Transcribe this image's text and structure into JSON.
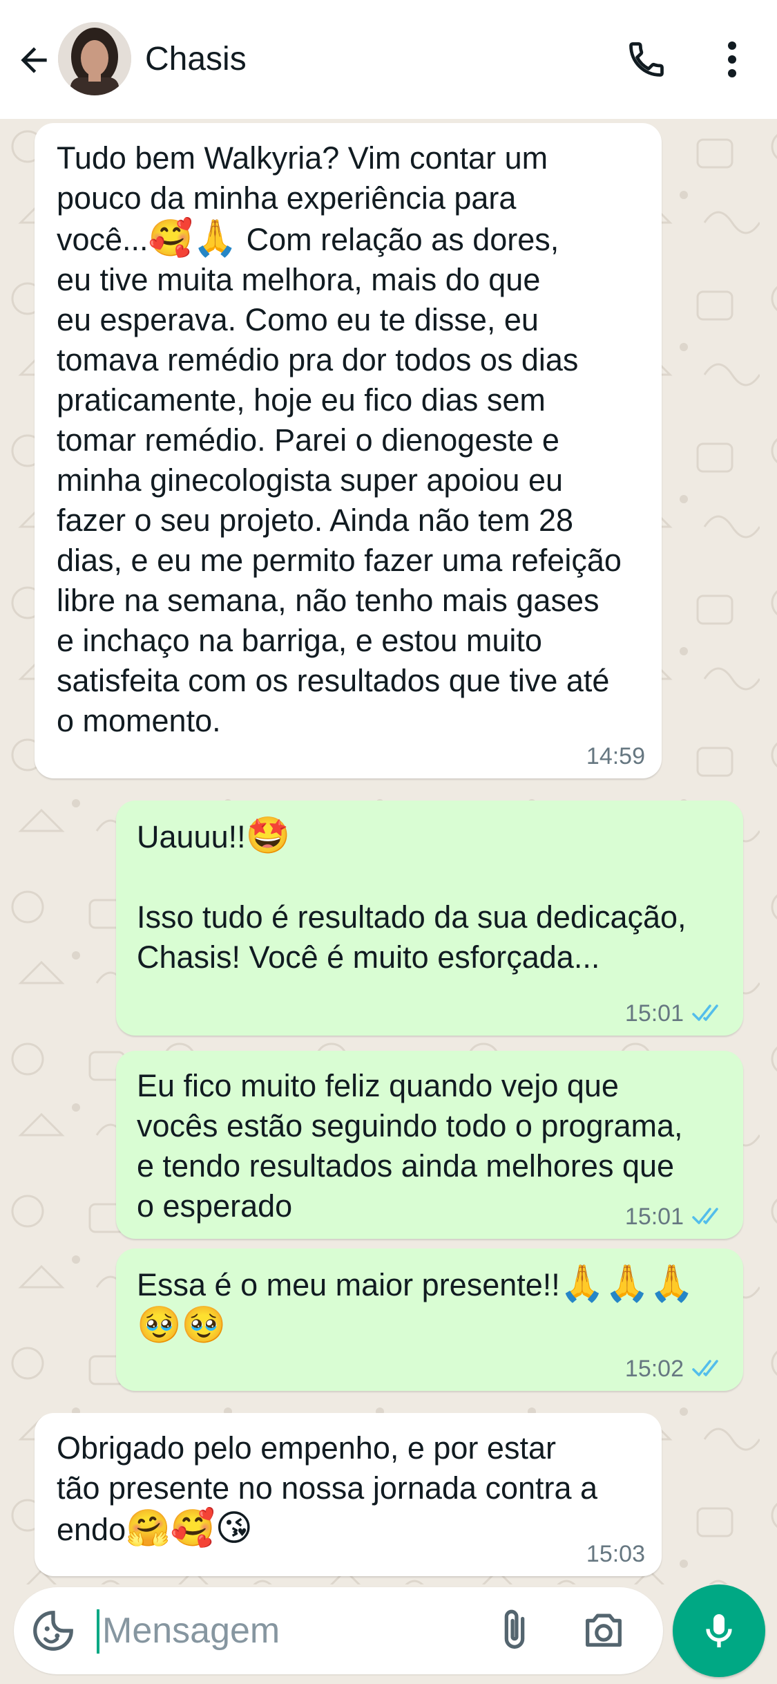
{
  "header": {
    "contact_name": "Chasis",
    "back_icon": "arrow-left-icon",
    "call_icon": "phone-icon",
    "menu_icon": "more-vertical-icon"
  },
  "messages": [
    {
      "direction": "incoming",
      "text_parts": [
        "Tudo bem Walkyria? Vim contar um\npouco da minha experiência para\nvocê...",
        "🥰🙏",
        " Com relação as dores,\neu tive muita melhora, mais do que\neu esperava. Como eu te disse, eu\ntomava remédio pra dor todos os dias\npraticamente, hoje eu fico dias sem\ntomar remédio. Parei o dienogeste e\nminha ginecologista super apoiou eu\nfazer o seu projeto. Ainda não tem 28\ndias, e eu me permito fazer uma refeição\nlibre na semana, não tenho mais gases\ne inchaço na barriga, e estou muito\nsatisfeita com os resultados que tive até\no momento."
      ],
      "time": "14:59"
    },
    {
      "direction": "outgoing",
      "text_parts": [
        "Uauuu!!",
        "🤩",
        "\n\nIsso tudo é resultado da sua dedicação,\nChasis! Você é muito esforçada..."
      ],
      "time": "15:01",
      "status": "read"
    },
    {
      "direction": "outgoing",
      "text_parts": [
        "Eu fico muito feliz quando vejo que\nvocês estão seguindo todo o programa,\ne tendo resultados ainda melhores que\no esperado"
      ],
      "time": "15:01",
      "status": "read"
    },
    {
      "direction": "outgoing",
      "text_parts": [
        "Essa é o meu maior presente!!",
        "🙏🙏🙏",
        "\n",
        "🥹🥹"
      ],
      "time": "15:02",
      "status": "read"
    },
    {
      "direction": "incoming",
      "text_parts": [
        "Obrigado pelo empenho, e por estar\ntão presente no nossa jornada contra a\nendo",
        "🤗🥰😘"
      ],
      "time": "15:03"
    }
  ],
  "composer": {
    "placeholder": "Mensagem",
    "value": "",
    "sticker_icon": "sticker-icon",
    "attach_icon": "paperclip-icon",
    "camera_icon": "camera-icon",
    "mic_icon": "microphone-icon"
  },
  "colors": {
    "incoming_bubble": "#ffffff",
    "outgoing_bubble": "#d9fdd3",
    "read_tick": "#53bdeb",
    "accent": "#00a884",
    "chat_background": "#efeae2"
  }
}
